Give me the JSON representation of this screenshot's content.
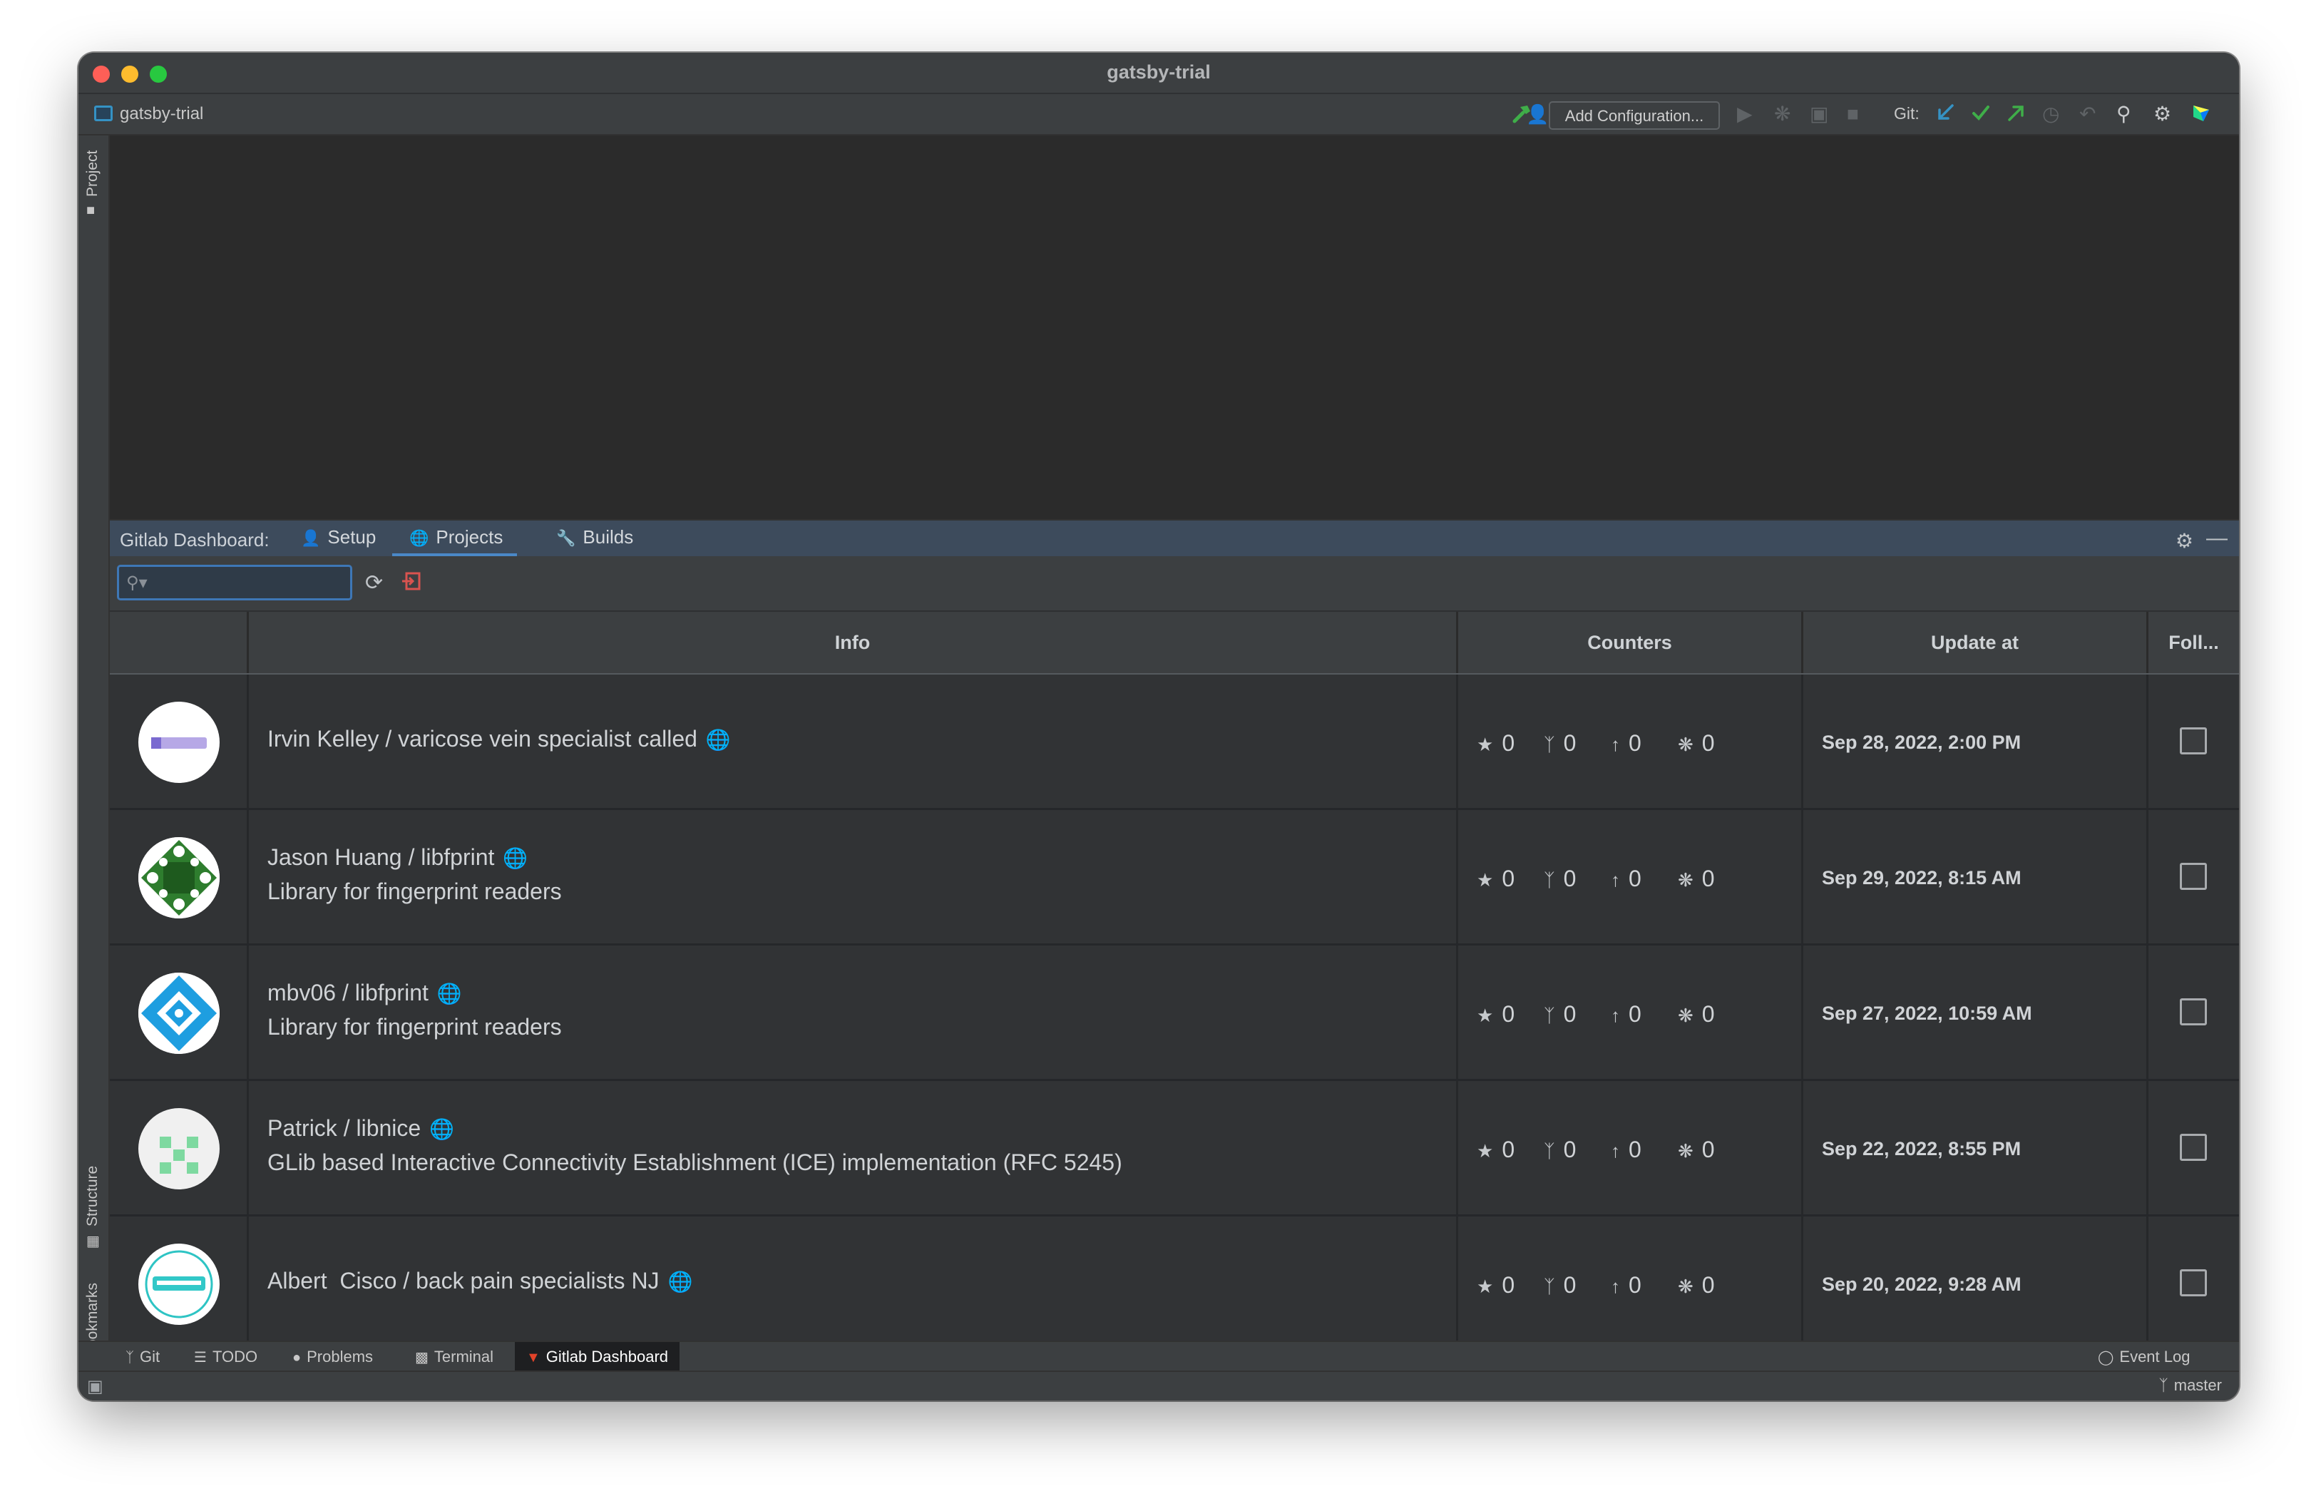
{
  "window": {
    "title": "gatsby-trial"
  },
  "navbar": {
    "project_name": "gatsby-trial",
    "add_configuration_label": "Add Configuration...",
    "git_label": "Git:"
  },
  "left_stripe": {
    "project_label": "Project",
    "structure_label": "Structure",
    "bookmarks_label": "Bookmarks"
  },
  "tool_window": {
    "title": "Gitlab Dashboard:",
    "tabs": [
      {
        "label": "Setup",
        "icon": "user-icon"
      },
      {
        "label": "Projects",
        "icon": "globe-icon",
        "active": true
      },
      {
        "label": "Builds",
        "icon": "wrench-icon"
      }
    ]
  },
  "search": {
    "placeholder": ""
  },
  "table": {
    "columns": [
      "",
      "Info",
      "Counters",
      "Update at",
      "Foll..."
    ],
    "rows": [
      {
        "title": "Irvin Kelley / varicose vein specialist called",
        "description": "",
        "stars": "0",
        "forks": "0",
        "merge_requests": "0",
        "issues": "0",
        "updated": "Sep 28, 2022, 2:00 PM",
        "followed": false
      },
      {
        "title": "Jason Huang / libfprint",
        "description": "Library for fingerprint readers",
        "stars": "0",
        "forks": "0",
        "merge_requests": "0",
        "issues": "0",
        "updated": "Sep 29, 2022, 8:15 AM",
        "followed": false
      },
      {
        "title": "mbv06 / libfprint",
        "description": "Library for fingerprint readers",
        "stars": "0",
        "forks": "0",
        "merge_requests": "0",
        "issues": "0",
        "updated": "Sep 27, 2022, 10:59 AM",
        "followed": false
      },
      {
        "title": "Patrick / libnice",
        "description": "GLib based Interactive Connectivity Establishment (ICE) implementation (RFC 5245)",
        "stars": "0",
        "forks": "0",
        "merge_requests": "0",
        "issues": "0",
        "updated": "Sep 22, 2022, 8:55 PM",
        "followed": false
      },
      {
        "title": "Albert  Cisco / back pain specialists NJ",
        "description": "",
        "stars": "0",
        "forks": "0",
        "merge_requests": "0",
        "issues": "0",
        "updated": "Sep 20, 2022, 9:28 AM",
        "followed": false
      }
    ]
  },
  "bottom_tabs": [
    {
      "label": "Git",
      "icon": "git-branch-icon"
    },
    {
      "label": "TODO",
      "icon": "list-icon"
    },
    {
      "label": "Problems",
      "icon": "info-icon"
    },
    {
      "label": "Terminal",
      "icon": "terminal-icon"
    },
    {
      "label": "Gitlab Dashboard",
      "icon": "gitlab-icon",
      "active": true
    }
  ],
  "event_log_label": "Event Log",
  "status": {
    "branch": "master"
  },
  "colors": {
    "accent": "#4a88c7",
    "gitlab": "#e24329",
    "green": "#3fae49",
    "blue": "#3592c4"
  }
}
